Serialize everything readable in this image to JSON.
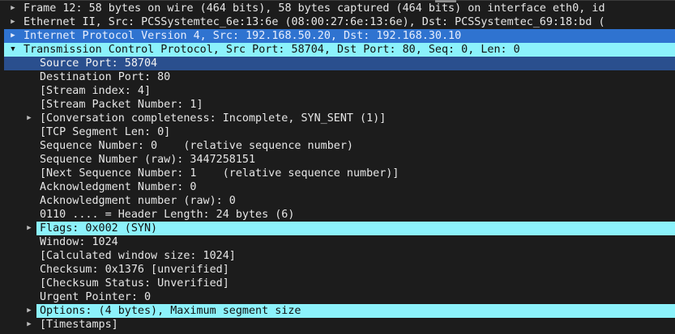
{
  "rows": [
    {
      "text": "Frame 12: 58 bytes on wire (464 bits), 58 bytes captured (464 bits) on interface eth0, id",
      "arrow": "▶"
    },
    {
      "text": "Ethernet II, Src: PCSSystemtec_6e:13:6e (08:00:27:6e:13:6e), Dst: PCSSystemtec_69:18:bd (",
      "arrow": "▶"
    },
    {
      "text": "Internet Protocol Version 4, Src: 192.168.50.20, Dst: 192.168.30.10",
      "arrow": "▶"
    },
    {
      "text": "Transmission Control Protocol, Src Port: 58704, Dst Port: 80, Seq: 0, Len: 0",
      "arrow": "▼"
    },
    {
      "text": "Source Port: 58704"
    },
    {
      "text": "Destination Port: 80"
    },
    {
      "text": "[Stream index: 4]"
    },
    {
      "text": "[Stream Packet Number: 1]"
    },
    {
      "text": "[Conversation completeness: Incomplete, SYN_SENT (1)]",
      "arrow": "▶"
    },
    {
      "text": "[TCP Segment Len: 0]"
    },
    {
      "text": "Sequence Number: 0    (relative sequence number)"
    },
    {
      "text": "Sequence Number (raw): 3447258151"
    },
    {
      "text": "[Next Sequence Number: 1    (relative sequence number)]"
    },
    {
      "text": "Acknowledgment Number: 0"
    },
    {
      "text": "Acknowledgment number (raw): 0"
    },
    {
      "text": "0110 .... = Header Length: 24 bytes (6)"
    },
    {
      "text": "Flags: 0x002 (SYN)",
      "arrow": "▶"
    },
    {
      "text": "Window: 1024"
    },
    {
      "text": "[Calculated window size: 1024]"
    },
    {
      "text": "Checksum: 0x1376 [unverified]"
    },
    {
      "text": "[Checksum Status: Unverified]"
    },
    {
      "text": "Urgent Pointer: 0"
    },
    {
      "text": "Options: (4 bytes), Maximum segment size",
      "arrow": "▶"
    },
    {
      "text": "[Timestamps]",
      "arrow": "▶"
    }
  ],
  "colors": {
    "background": "#1c1c1c",
    "ip_highlight": "#2f73d0",
    "tcp_highlight": "#8cf2fb",
    "selected_row": "#2a4f8e"
  },
  "icons": {
    "collapsed": "triangle-right-icon",
    "expanded": "triangle-down-icon"
  }
}
